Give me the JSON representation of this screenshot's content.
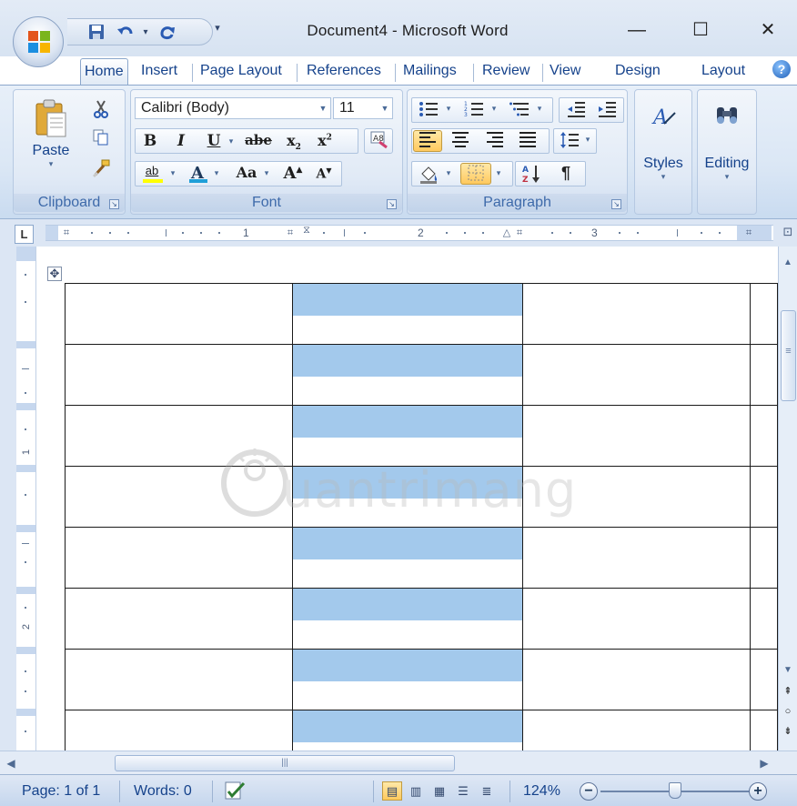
{
  "window": {
    "title": "Document4 - Microsoft Word",
    "minimize_glyph": "—",
    "maximize_glyph": "☐",
    "close_glyph": "✕"
  },
  "quick_access": {
    "save_icon": "save-icon",
    "undo_icon": "undo-icon",
    "redo_icon": "redo-icon",
    "customize_glyph": "▾"
  },
  "tabs": [
    {
      "label": "Home",
      "active": true
    },
    {
      "label": "Insert"
    },
    {
      "label": "Page Layout"
    },
    {
      "label": "References"
    },
    {
      "label": "Mailings"
    },
    {
      "label": "Review"
    },
    {
      "label": "View"
    },
    {
      "label": "Design"
    },
    {
      "label": "Layout"
    }
  ],
  "ribbon": {
    "clipboard": {
      "label": "Clipboard",
      "paste_label": "Paste",
      "paste_dd": "▾"
    },
    "font": {
      "label": "Font",
      "font_name": "Calibri (Body)",
      "font_size": "11",
      "bold": "B",
      "italic": "I",
      "underline": "U",
      "strike": "abe",
      "subscript": "x",
      "superscript": "x",
      "change_case": "Aa",
      "grow": "A",
      "shrink": "A",
      "font_color": "A",
      "highlight": "ab"
    },
    "paragraph": {
      "label": "Paragraph",
      "pilcrow": "¶"
    },
    "styles": {
      "label": "Styles",
      "dd": "▾"
    },
    "editing": {
      "label": "Editing",
      "dd": "▾"
    }
  },
  "ruler": {
    "corner_glyph": "L",
    "numbers": [
      "1",
      "2",
      "3"
    ],
    "vnumbers": [
      "1",
      "2"
    ]
  },
  "watermark": {
    "text": "uantrimang"
  },
  "table": {
    "rows": 8,
    "columns": 4,
    "selected_column": 2,
    "selection_color": "#a3c9ec"
  },
  "scrollbar": {
    "up_arrow": "▲",
    "down_arrow": "▼",
    "prev_page": "⯭",
    "browse_object": "○",
    "next_page": "⯯",
    "left_arrow": "◀",
    "right_arrow": "▶",
    "grip": "|||",
    "vgrip": "≡"
  },
  "status": {
    "page": "Page: 1 of 1",
    "words": "Words: 0",
    "zoom": "124%",
    "zoom_out": "−",
    "zoom_in": "+"
  },
  "colors": {
    "ribbon_text": "#15428b",
    "selection": "#a3c9ec",
    "accent_highlight": "#ffc95e"
  }
}
